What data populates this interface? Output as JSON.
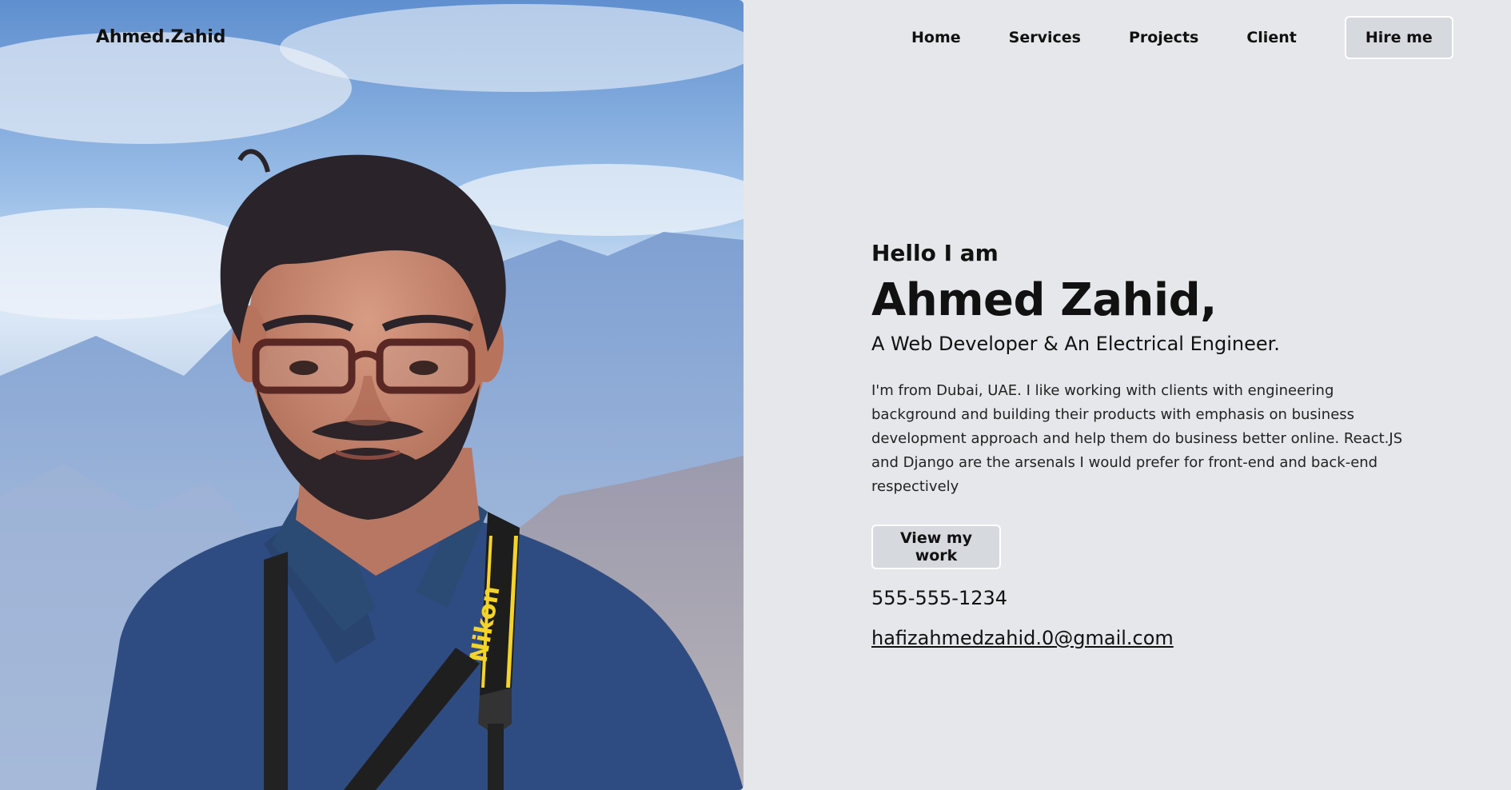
{
  "header": {
    "logo": "Ahmed.Zahid",
    "nav": {
      "home": "Home",
      "services": "Services",
      "projects": "Projects",
      "client": "Client",
      "hire": "Hire me"
    }
  },
  "hero": {
    "greeting": "Hello I am",
    "name": "Ahmed Zahid,",
    "role": "A Web Developer & An Electrical Engineer.",
    "bio": "I'm from Dubai, UAE. I like working with clients with engineering background and building their products with emphasis on business development approach and help them do business better online. React.JS and Django are the arsenals I would prefer for front-end and back-end respectively",
    "cta": "View my work",
    "phone": "555-555-1234",
    "email": "hafizahmedzahid.0@gmail.com"
  },
  "photo": {
    "camera_strap_brand": "Nikon"
  },
  "colors": {
    "page_background": "#e6e7ea",
    "button_background": "#d6d9de",
    "text": "#111111"
  }
}
